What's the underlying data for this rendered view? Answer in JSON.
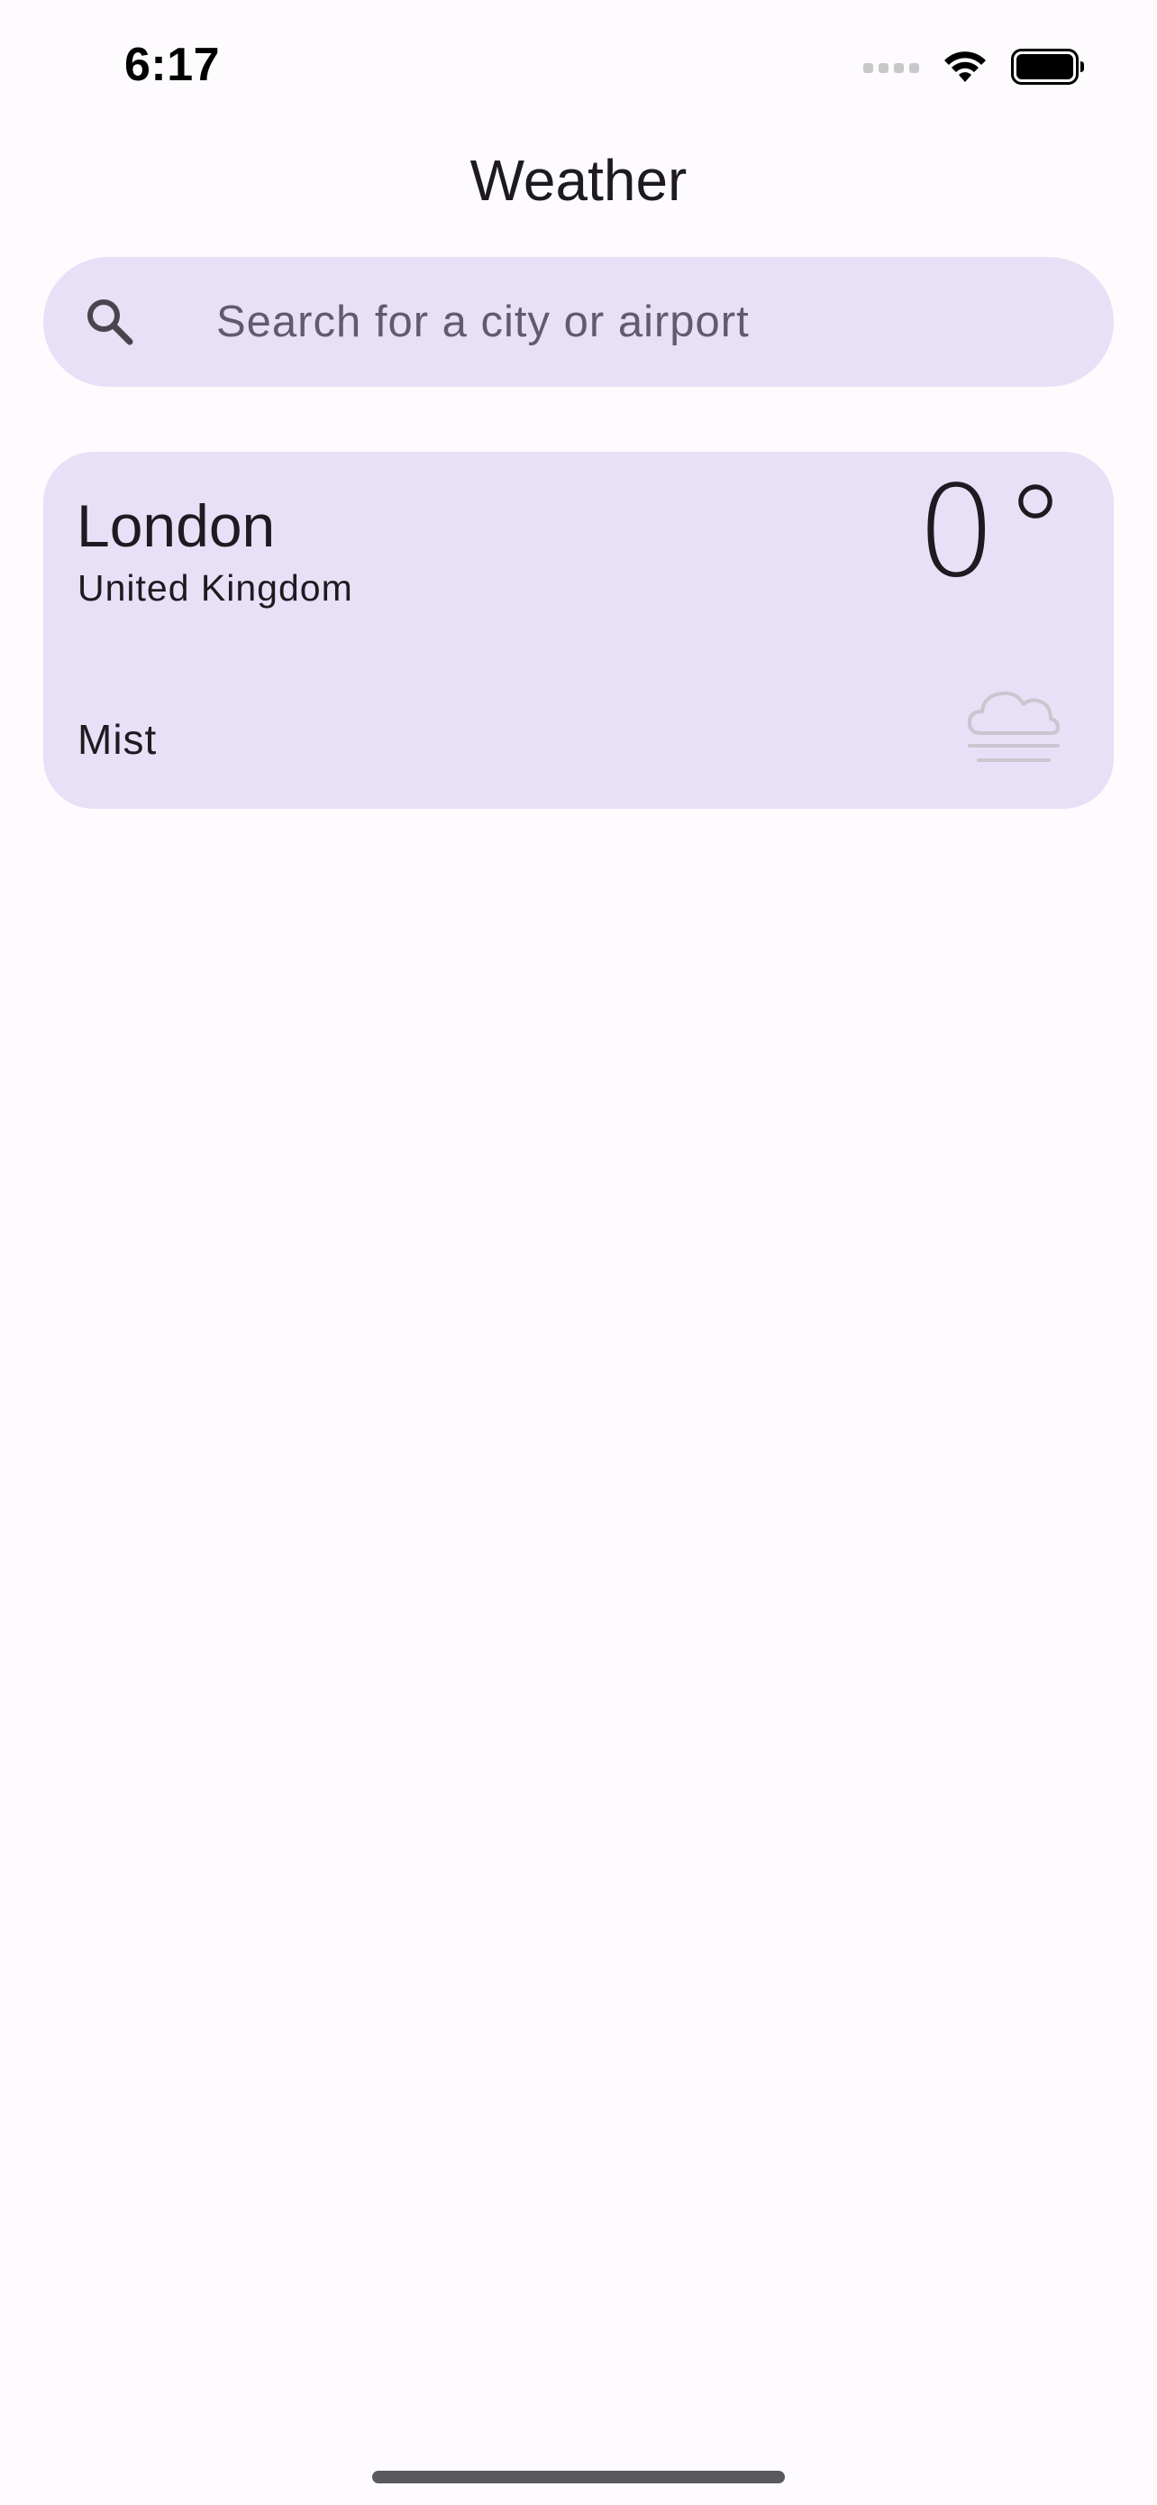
{
  "status_bar": {
    "time": "6:17",
    "signal_icon": "cellular-signal-icon",
    "wifi_icon": "wifi-icon",
    "battery_icon": "battery-icon"
  },
  "header": {
    "title": "Weather"
  },
  "search": {
    "placeholder": "Search for a city or airport",
    "value": "",
    "icon": "search-icon"
  },
  "locations": [
    {
      "city": "London",
      "country": "United Kingdom",
      "temperature": "0°",
      "condition": "Mist",
      "condition_icon": "mist-icon"
    }
  ],
  "colors": {
    "background": "#fdfbfe",
    "card": "#e7e0f6",
    "text": "#1d1b20",
    "placeholder": "#625b6f"
  }
}
